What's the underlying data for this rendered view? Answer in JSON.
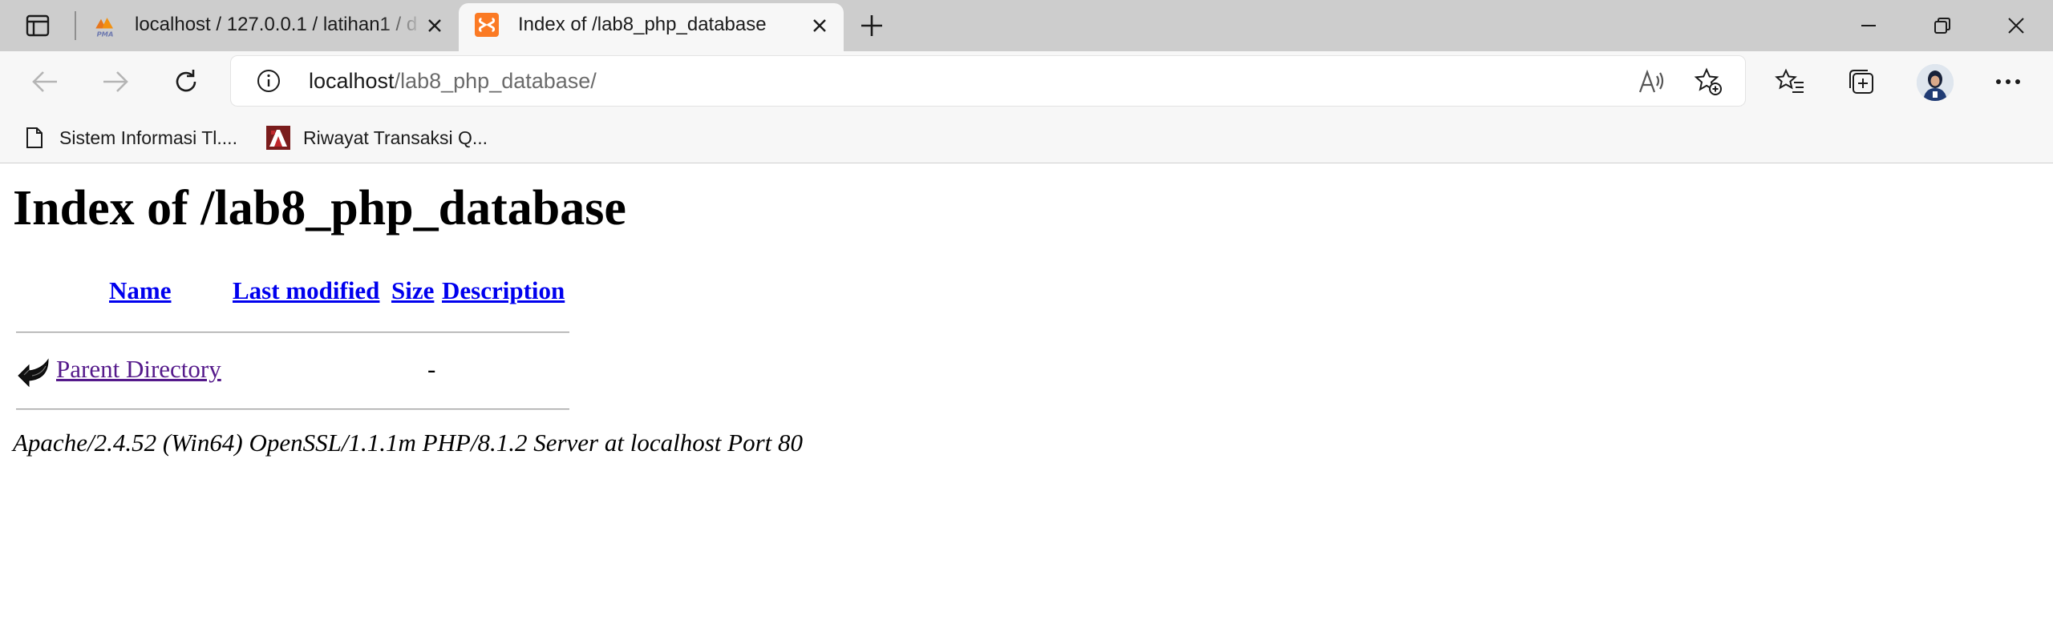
{
  "browser": {
    "tabs": [
      {
        "title": "localhost / 127.0.0.1 / latihan1 / d",
        "favicon": "phpmyadmin-icon",
        "favicon_text": "PMA",
        "active": false
      },
      {
        "title": "Index of /lab8_php_database",
        "favicon": "xampp-icon",
        "active": true
      }
    ],
    "address_bar": {
      "host": "localhost",
      "path": "/lab8_php_database/"
    },
    "bookmarks": [
      {
        "label": "Sistem Informasi Tl....",
        "icon": "page-icon"
      },
      {
        "label": "Riwayat Transaksi Q...",
        "icon": "site-logo-icon"
      }
    ]
  },
  "page": {
    "heading": "Index of /lab8_php_database",
    "columns": {
      "name": "Name",
      "last_modified": "Last modified",
      "size": "Size",
      "description": "Description"
    },
    "rows": [
      {
        "name": "Parent Directory",
        "last_modified": "",
        "size": "-",
        "description": "",
        "icon": "back-arrow-icon"
      }
    ],
    "server_signature": "Apache/2.4.52 (Win64) OpenSSL/1.1.1m PHP/8.1.2 Server at localhost Port 80"
  },
  "colors": {
    "link": "#0000ee",
    "visited_link": "#551a8b",
    "tabstrip": "#cdcdcd",
    "toolbar": "#f7f7f7",
    "xampp_orange": "#fb7a24"
  }
}
